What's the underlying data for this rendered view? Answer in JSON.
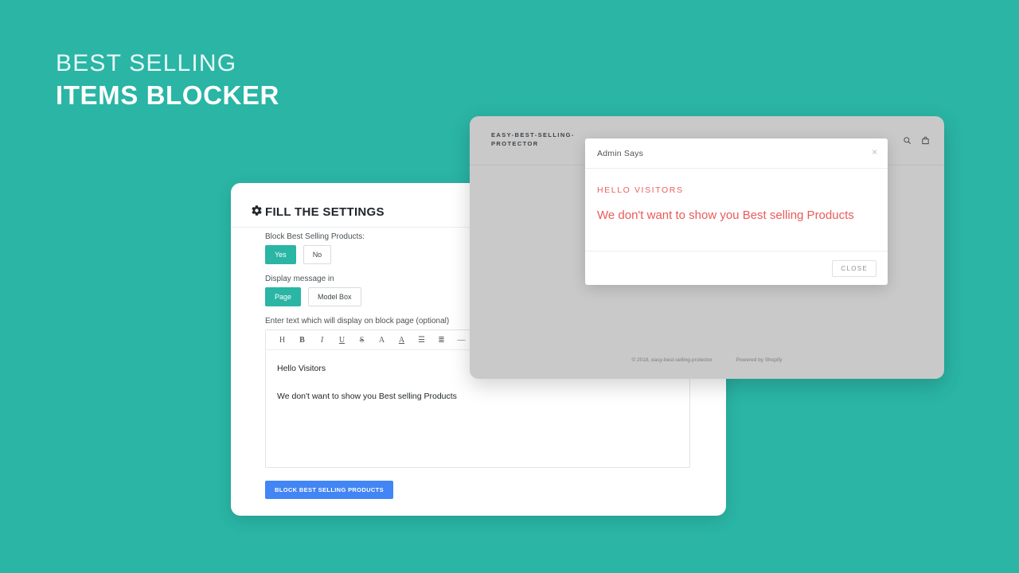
{
  "headline": {
    "line1": "BEST SELLING",
    "line2": "ITEMS BLOCKER"
  },
  "colors": {
    "background_teal": "#2ab5a5",
    "accent_teal": "#2ab5a5",
    "submit_blue": "#4285f4",
    "message_red": "#ea5a58",
    "window_gray": "#c9c9c9"
  },
  "admin_panel": {
    "title": "FILL THE SETTINGS",
    "gear_icon": "gear-icon",
    "block_products": {
      "label": "Block Best Selling Products:",
      "options": [
        "Yes",
        "No"
      ],
      "selected": "Yes"
    },
    "display_message": {
      "label": "Display message in",
      "options": [
        "Page",
        "Model Box"
      ],
      "selected": "Page"
    },
    "editor": {
      "label": "Enter text which will display on block page (optional)",
      "toolbar": [
        {
          "name": "heading-icon",
          "glyph": "H"
        },
        {
          "name": "bold-icon",
          "glyph": "B"
        },
        {
          "name": "italic-icon",
          "glyph": "I"
        },
        {
          "name": "underline-icon",
          "glyph": "U"
        },
        {
          "name": "strikethrough-icon",
          "glyph": "S"
        },
        {
          "name": "font-size-icon",
          "glyph": "A"
        },
        {
          "name": "text-color-icon",
          "glyph": "A"
        },
        {
          "name": "ordered-list-icon",
          "glyph": "☰"
        },
        {
          "name": "unordered-list-icon",
          "glyph": "≣"
        },
        {
          "name": "horizontal-rule-icon",
          "glyph": "—"
        },
        {
          "name": "insert-image-icon",
          "glyph": "▣"
        }
      ],
      "paragraphs": [
        "Hello Visitors",
        "We don't want to show you Best selling Products"
      ]
    },
    "submit_label": "BLOCK BEST SELLING PRODUCTS"
  },
  "storefront": {
    "brand": "EASY-BEST-SELLING-PROTECTOR",
    "icons": [
      "search-icon",
      "shopping-bag-icon"
    ],
    "footer": {
      "copyright": "© 2018, easy-best-selling-protector",
      "powered_by": "Powered by Shopify"
    }
  },
  "modal": {
    "title": "Admin Says",
    "close_x": "×",
    "kicker": "HELLO VISITORS",
    "message": "We don't want to show you Best selling Products",
    "close_label": "CLOSE"
  }
}
